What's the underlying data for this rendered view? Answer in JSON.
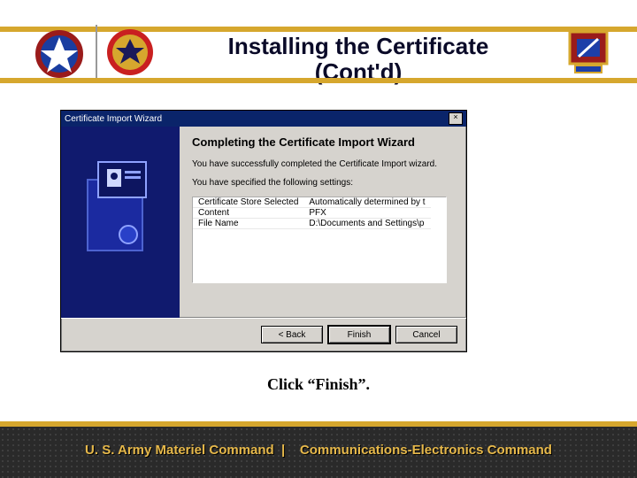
{
  "header": {
    "title": "Installing the Certificate (Cont'd)"
  },
  "wizard": {
    "titlebar": "Certificate Import Wizard",
    "heading": "Completing the Certificate Import Wizard",
    "msg1": "You have successfully completed the Certificate Import wizard.",
    "msg2": "You have specified the following settings:",
    "rows": {
      "r0a": "Certificate Store Selected",
      "r0b": "Automatically determined by t",
      "r1a": "Content",
      "r1b": "PFX",
      "r2a": "File Name",
      "r2b": "D:\\Documents and Settings\\p"
    },
    "buttons": {
      "back": "< Back",
      "finish": "Finish",
      "cancel": "Cancel"
    }
  },
  "instruction": "Click “Finish”.",
  "footer": {
    "left": "U. S. Army Materiel Command",
    "sep": "|",
    "right": "Communications-Electronics Command"
  }
}
